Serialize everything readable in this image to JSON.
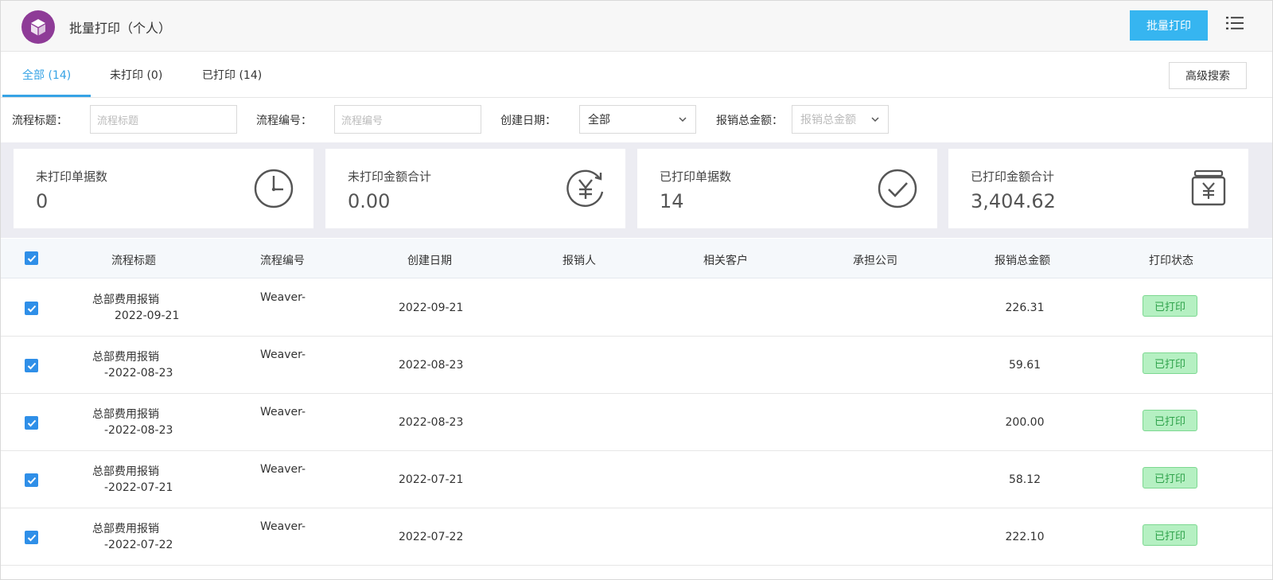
{
  "header": {
    "title": "批量打印（个人）",
    "primary_button": "批量打印"
  },
  "tabs": [
    {
      "label": "全部 (14)",
      "active": true
    },
    {
      "label": "未打印 (0)",
      "active": false
    },
    {
      "label": "已打印 (14)",
      "active": false
    }
  ],
  "advanced_search": "高级搜索",
  "filters": {
    "title_label": "流程标题：",
    "title_placeholder": "流程标题",
    "code_label": "流程编号：",
    "code_placeholder": "流程编号",
    "date_label": "创建日期：",
    "date_value": "全部",
    "amount_label": "报销总金额：",
    "amount_placeholder": "报销总金额"
  },
  "stats": [
    {
      "label": "未打印单据数",
      "value": "0",
      "icon": "clock-icon"
    },
    {
      "label": "未打印金额合计",
      "value": "0.00",
      "icon": "yen-refresh-icon"
    },
    {
      "label": "已打印单据数",
      "value": "14",
      "icon": "check-circle-icon"
    },
    {
      "label": "已打印金额合计",
      "value": "3,404.62",
      "icon": "yen-wallet-icon"
    }
  ],
  "table": {
    "columns": [
      "流程标题",
      "流程编号",
      "创建日期",
      "报销人",
      "相关客户",
      "承担公司",
      "报销总金额",
      "打印状态"
    ],
    "rows": [
      {
        "title1": "总部费用报销",
        "title2": "2022-09-21",
        "code": "Weaver-",
        "date": "2022-09-21",
        "amount": "226.31",
        "status": "已打印"
      },
      {
        "title1": "总部费用报销",
        "title2": "-2022-08-23",
        "code": "Weaver-",
        "date": "2022-08-23",
        "amount": "59.61",
        "status": "已打印"
      },
      {
        "title1": "总部费用报销",
        "title2": "-2022-08-23",
        "code": "Weaver-",
        "date": "2022-08-23",
        "amount": "200.00",
        "status": "已打印"
      },
      {
        "title1": "总部费用报销",
        "title2": "-2022-07-21",
        "code": "Weaver-",
        "date": "2022-07-21",
        "amount": "58.12",
        "status": "已打印"
      },
      {
        "title1": "总部费用报销",
        "title2": "-2022-07-22",
        "code": "Weaver-",
        "date": "2022-07-22",
        "amount": "222.10",
        "status": "已打印"
      }
    ]
  },
  "colors": {
    "accent": "#36a3e5",
    "primary_button": "#36b5f0",
    "checkbox": "#2f8fe8",
    "logo": "#8e3b97",
    "status_bg": "#b5f0c2",
    "status_text": "#2ea24a"
  }
}
